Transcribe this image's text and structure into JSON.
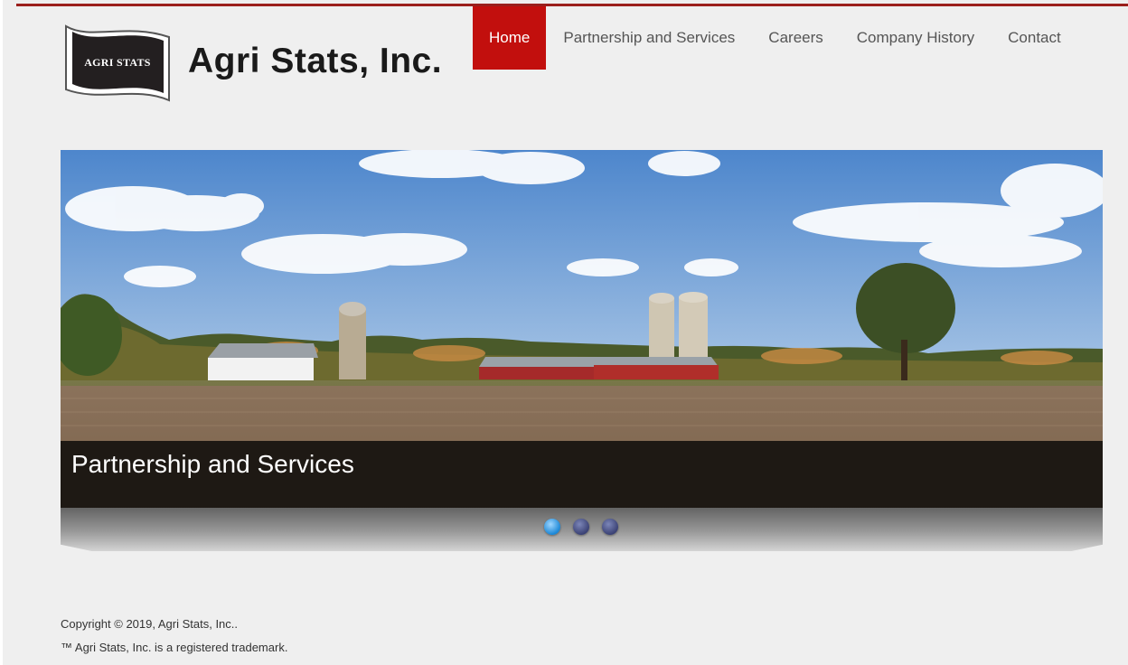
{
  "header": {
    "logo_text": "AGRI STATS",
    "site_title": "Agri Stats, Inc."
  },
  "nav": {
    "items": [
      {
        "label": "Home",
        "active": true
      },
      {
        "label": "Partnership and Services",
        "active": false
      },
      {
        "label": "Careers",
        "active": false
      },
      {
        "label": "Company History",
        "active": false
      },
      {
        "label": "Contact",
        "active": false
      }
    ]
  },
  "slider": {
    "caption": "Partnership and Services",
    "slide_count": 3,
    "active_slide": 1
  },
  "footer": {
    "copyright": "Copyright © 2019, Agri Stats, Inc..",
    "trademark": "™ Agri Stats, Inc. is a registered trademark."
  },
  "colors": {
    "accent_red": "#c20f0d",
    "top_rule": "#9b1f1c",
    "background": "#efefef",
    "caption_bg": "#16120f",
    "active_dot": "#1b87d6"
  }
}
